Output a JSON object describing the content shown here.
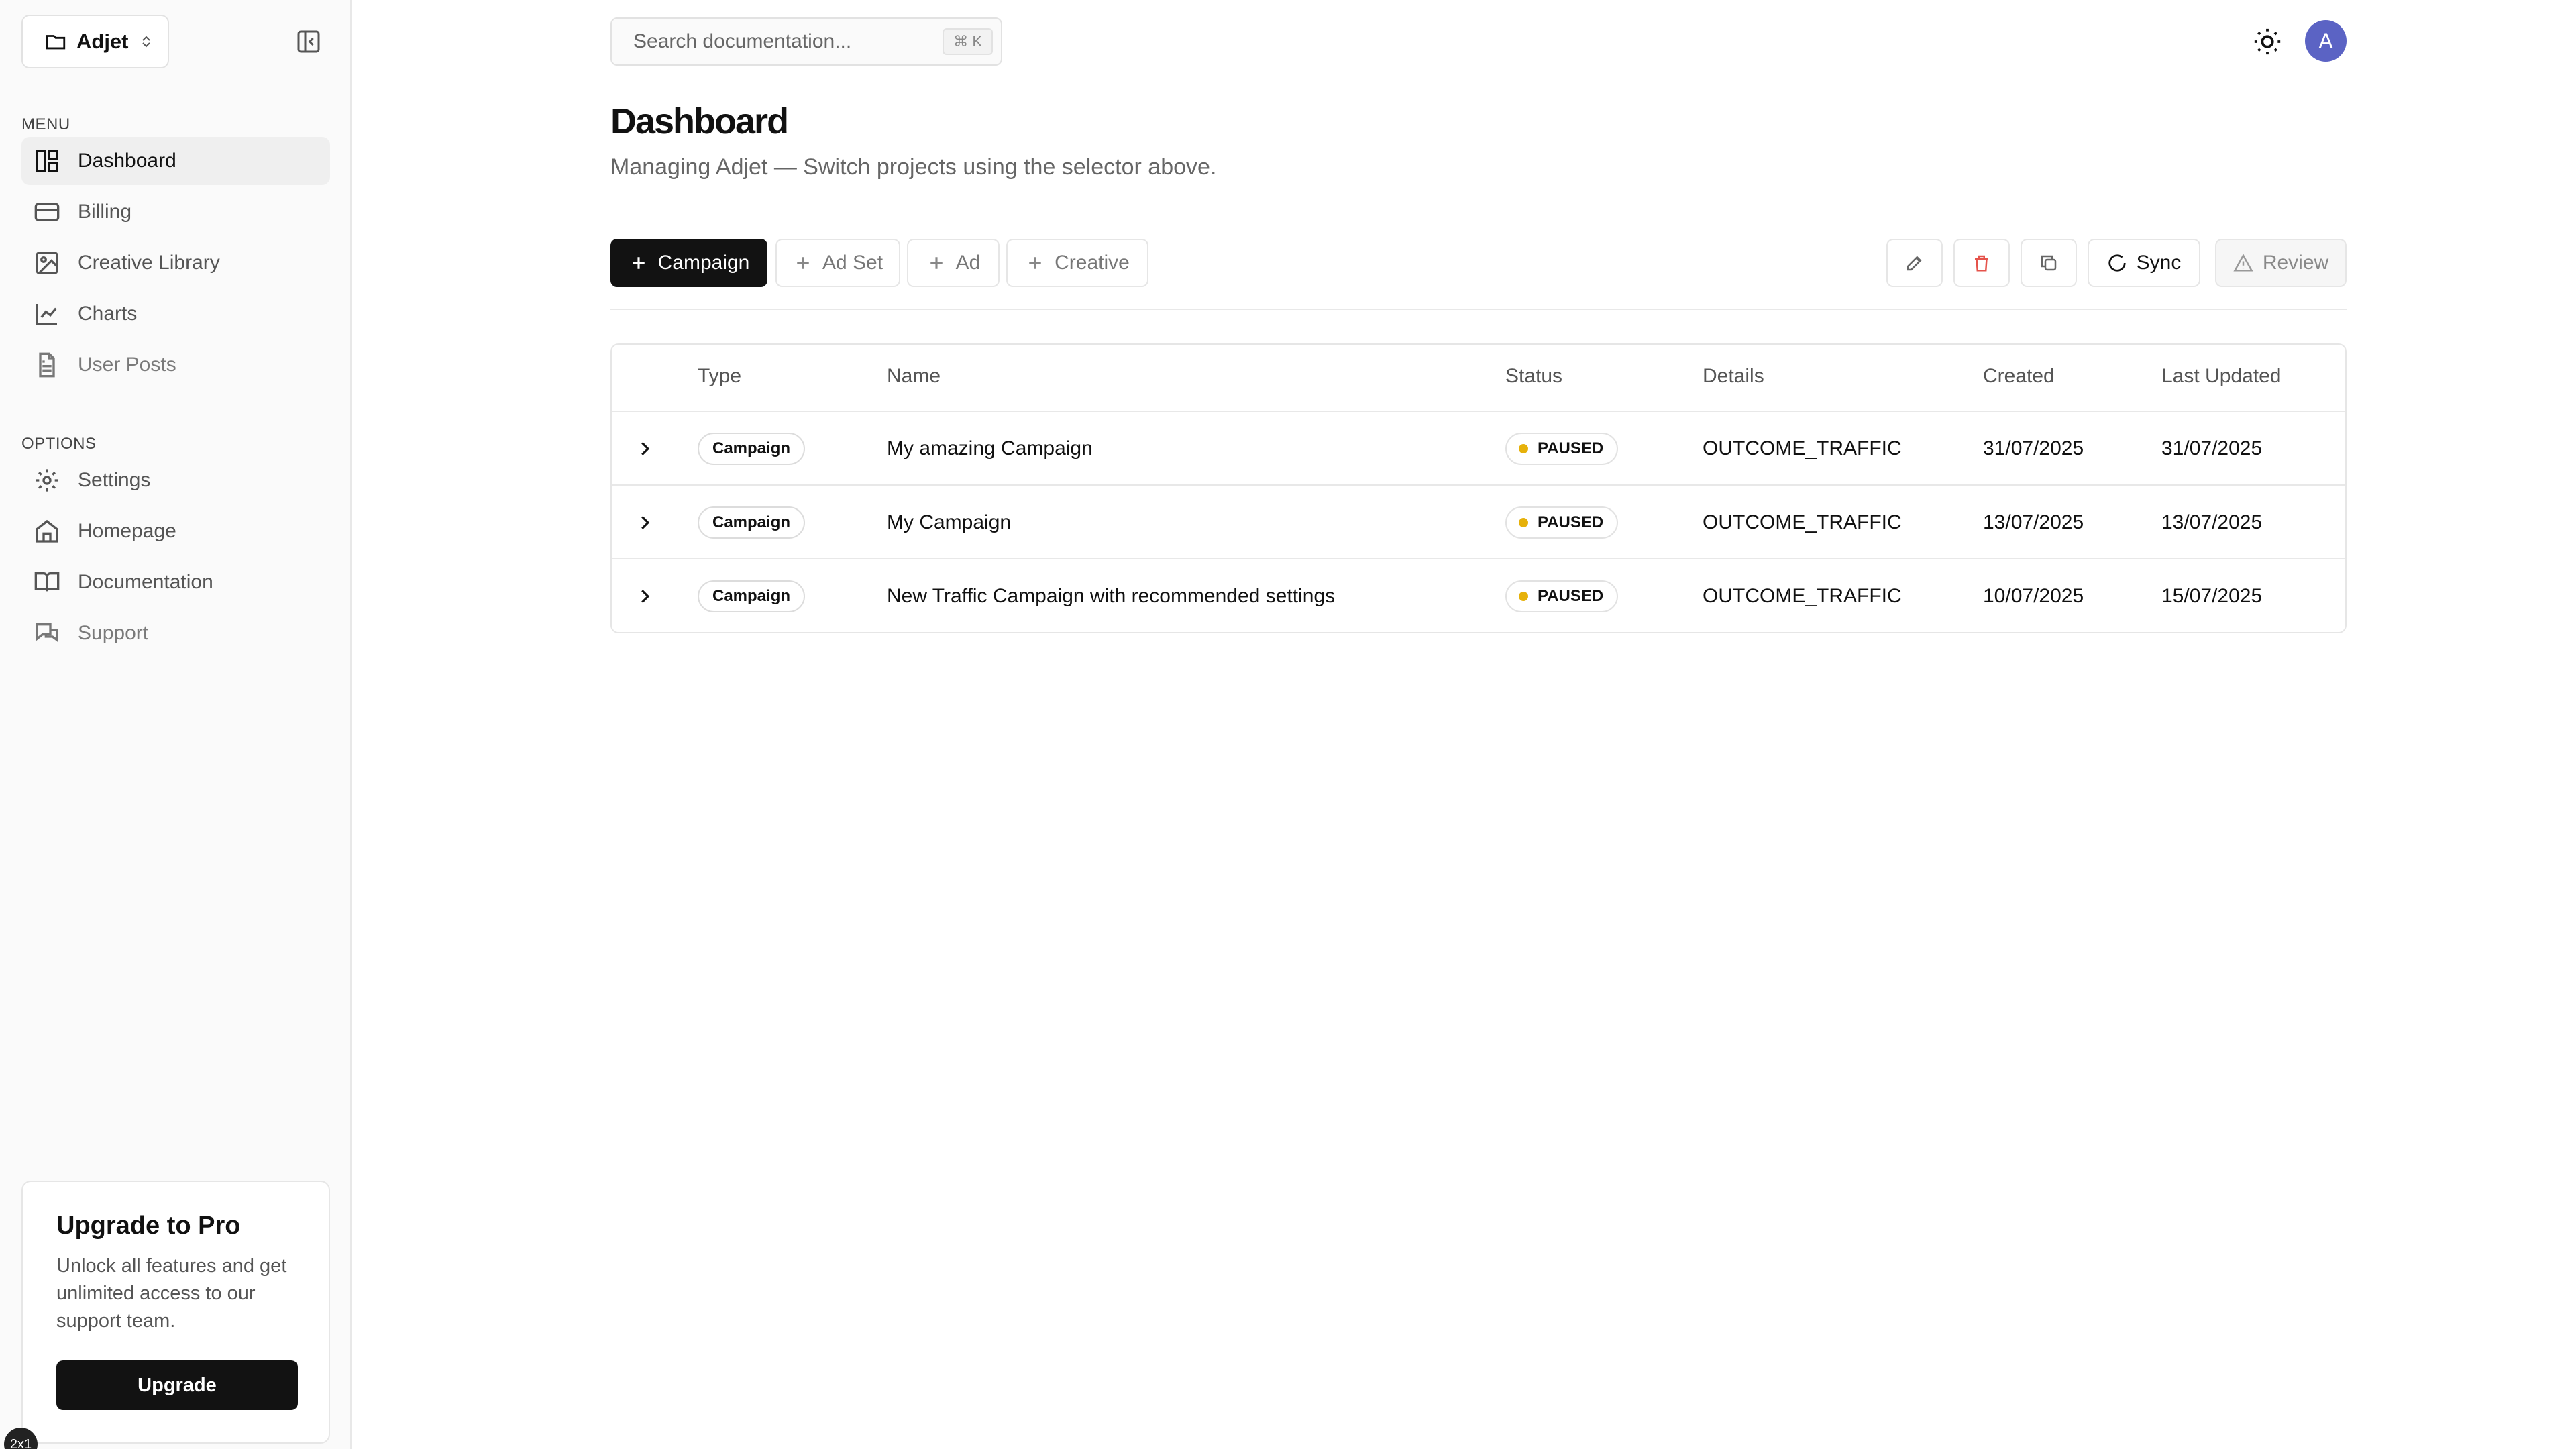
{
  "sidebar": {
    "project": "Adjet",
    "menu_label": "MENU",
    "menu": [
      {
        "label": "Dashboard",
        "icon": "dashboard-icon"
      },
      {
        "label": "Billing",
        "icon": "credit-card-icon"
      },
      {
        "label": "Creative Library",
        "icon": "image-icon"
      },
      {
        "label": "Charts",
        "icon": "line-chart-icon"
      },
      {
        "label": "User Posts",
        "icon": "document-icon"
      }
    ],
    "options_label": "OPTIONS",
    "options": [
      {
        "label": "Settings",
        "icon": "gear-icon"
      },
      {
        "label": "Homepage",
        "icon": "home-icon"
      },
      {
        "label": "Documentation",
        "icon": "book-icon"
      },
      {
        "label": "Support",
        "icon": "chat-icon"
      }
    ],
    "upgrade": {
      "title": "Upgrade to Pro",
      "text": "Unlock all features and get unlimited access to our support team.",
      "button": "Upgrade"
    },
    "corner_badge": "2x1"
  },
  "header": {
    "search_placeholder": "Search documentation...",
    "shortcut": "⌘ K",
    "avatar_letter": "A"
  },
  "page": {
    "title": "Dashboard",
    "subtitle": "Managing Adjet — Switch projects using the selector above."
  },
  "toolbar": {
    "campaign": "Campaign",
    "ad_set": "Ad Set",
    "ad": "Ad",
    "creative": "Creative",
    "sync": "Sync",
    "review": "Review"
  },
  "table": {
    "columns": [
      "Type",
      "Name",
      "Status",
      "Details",
      "Created",
      "Last Updated"
    ],
    "rows": [
      {
        "type": "Campaign",
        "name": "My amazing Campaign",
        "status": "PAUSED",
        "details": "OUTCOME_TRAFFIC",
        "created": "31/07/2025",
        "updated": "31/07/2025"
      },
      {
        "type": "Campaign",
        "name": "My Campaign",
        "status": "PAUSED",
        "details": "OUTCOME_TRAFFIC",
        "created": "13/07/2025",
        "updated": "13/07/2025"
      },
      {
        "type": "Campaign",
        "name": "New Traffic Campaign with recommended settings",
        "status": "PAUSED",
        "details": "OUTCOME_TRAFFIC",
        "created": "10/07/2025",
        "updated": "15/07/2025"
      }
    ]
  },
  "colors": {
    "primary": "#121212",
    "avatar": "#5b63c4",
    "paused_dot": "#e6b10a",
    "delete": "#e5534b"
  }
}
